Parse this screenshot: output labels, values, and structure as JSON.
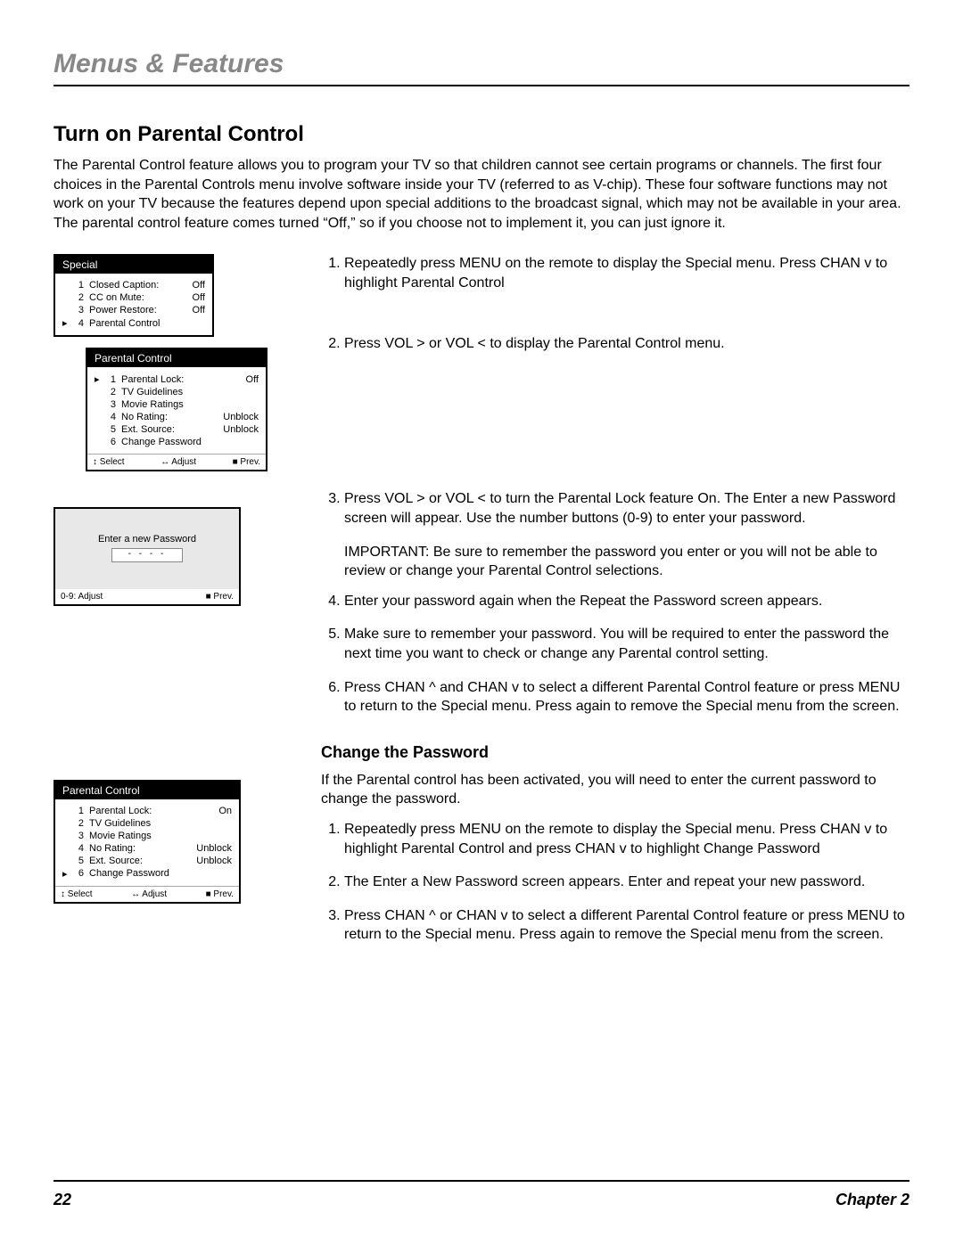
{
  "chapter_title": "Menus & Features",
  "section_title": "Turn on Parental Control",
  "intro": "The Parental Control feature allows you to program your TV so that children cannot see certain programs or channels. The first four choices in the Parental Controls menu involve software inside your TV (referred to as V-chip). These four software functions may not work on your TV because the features depend upon special additions to the broadcast signal, which may not be available in your area. The parental control feature comes turned “Off,” so if you choose not to implement it, you can just ignore it.",
  "osd_special": {
    "title": "Special",
    "items": [
      {
        "n": "1",
        "label": "Closed Caption:",
        "val": "Off",
        "cursor": ""
      },
      {
        "n": "2",
        "label": "CC on Mute:",
        "val": "Off",
        "cursor": ""
      },
      {
        "n": "3",
        "label": "Power Restore:",
        "val": "Off",
        "cursor": ""
      },
      {
        "n": "4",
        "label": "Parental Control",
        "val": "",
        "cursor": "▸"
      }
    ]
  },
  "osd_pc1": {
    "title": "Parental Control",
    "items": [
      {
        "n": "1",
        "label": "Parental Lock:",
        "val": "Off",
        "cursor": "▸"
      },
      {
        "n": "2",
        "label": "TV Guidelines",
        "val": "",
        "cursor": ""
      },
      {
        "n": "3",
        "label": "Movie Ratings",
        "val": "",
        "cursor": ""
      },
      {
        "n": "4",
        "label": "No Rating:",
        "val": "Unblock",
        "cursor": ""
      },
      {
        "n": "5",
        "label": "Ext. Source:",
        "val": "Unblock",
        "cursor": ""
      },
      {
        "n": "6",
        "label": "Change Password",
        "val": "",
        "cursor": ""
      }
    ],
    "footer": {
      "a": "↕ Select",
      "b": "↔ Adjust",
      "c": "■ Prev."
    }
  },
  "pw": {
    "title": "Enter a new Password",
    "dashes": "- - - -",
    "footer": {
      "a": "0-9: Adjust",
      "b": "■ Prev."
    }
  },
  "steps": [
    "Repeatedly press MENU on the remote to display the Special menu. Press CHAN v to highlight Parental Control",
    "Press VOL > or VOL <  to display the Parental Control menu.",
    "Press VOL > or VOL <  to turn the Parental Lock feature On. The Enter a new Password screen will appear. Use the number buttons (0-9) to enter your password.",
    "Enter your password again when the Repeat the Password screen appears.",
    "Make sure to remember your password. You will be required to enter the password the next time you want to check or change any Parental control setting.",
    "Press CHAN ^ and CHAN v to select a different Parental Control feature or press MENU to return to the Special menu. Press again to remove the Special menu from the screen."
  ],
  "important": "IMPORTANT: Be sure to remember the password you enter or you will not be able to review or change your Parental Control selections.",
  "change_pw": {
    "title": "Change the Password",
    "intro": "If the Parental control has been activated, you will need to enter the current password to change the password.",
    "steps": [
      "Repeatedly press MENU on the remote to display the Special menu. Press CHAN v to highlight Parental Control and press CHAN v to highlight  Change Password",
      "The Enter a New Password screen appears. Enter and repeat your new password.",
      "Press CHAN ^ or CHAN v  to select a different Parental Control feature or press MENU to return to the Special menu. Press again to remove the Special menu from the screen."
    ]
  },
  "osd_pc2": {
    "title": "Parental Control",
    "items": [
      {
        "n": "1",
        "label": "Parental Lock:",
        "val": "On",
        "cursor": ""
      },
      {
        "n": "2",
        "label": "TV Guidelines",
        "val": "",
        "cursor": ""
      },
      {
        "n": "3",
        "label": "Movie Ratings",
        "val": "",
        "cursor": ""
      },
      {
        "n": "4",
        "label": "No Rating:",
        "val": "Unblock",
        "cursor": ""
      },
      {
        "n": "5",
        "label": "Ext. Source:",
        "val": "Unblock",
        "cursor": ""
      },
      {
        "n": "6",
        "label": "Change Password",
        "val": "",
        "cursor": "▸"
      }
    ],
    "footer": {
      "a": "↕ Select",
      "b": "↔ Adjust",
      "c": "■ Prev."
    }
  },
  "footer": {
    "page": "22",
    "chap": "Chapter 2"
  }
}
